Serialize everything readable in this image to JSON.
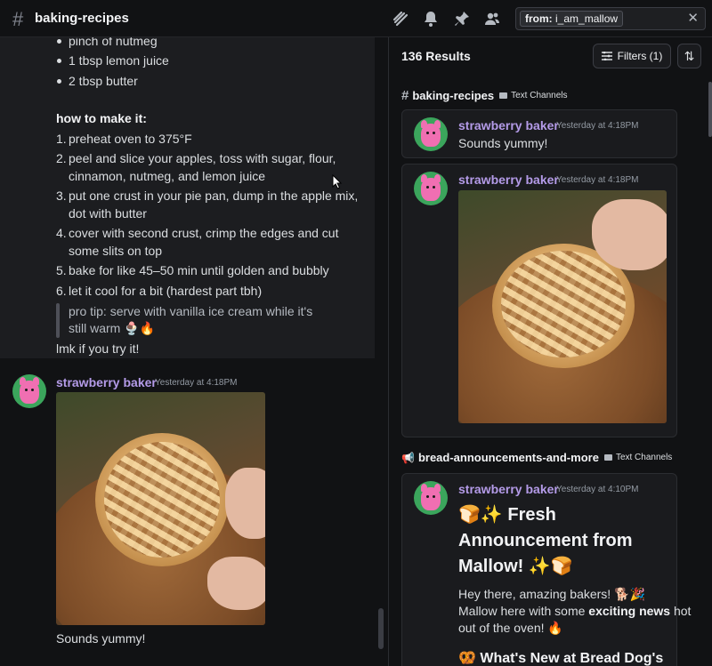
{
  "header": {
    "channel": "baking-recipes",
    "search_from": "from:",
    "search_user": "i_am_mallow",
    "icons": [
      "threads-icon",
      "bell-icon",
      "pin-icon",
      "members-icon"
    ]
  },
  "recipe": {
    "ingredients_tail": [
      "pinch of nutmeg",
      "1 tbsp lemon juice",
      "2 tbsp butter"
    ],
    "how_to_heading": "how to make it:",
    "steps": [
      {
        "n": "1.",
        "lines": [
          "preheat oven to 375°F"
        ]
      },
      {
        "n": "2.",
        "lines": [
          "peel and slice your apples, toss with sugar, flour,",
          "cinnamon, nutmeg, and lemon juice"
        ]
      },
      {
        "n": "3.",
        "lines": [
          "put one crust in your pie pan, dump in the apple mix,",
          "dot with butter"
        ]
      },
      {
        "n": "4.",
        "lines": [
          "cover with second crust, crimp the edges and cut",
          "some slits on top"
        ]
      },
      {
        "n": "5.",
        "lines": [
          "bake for like 45–50 min until golden and bubbly"
        ]
      },
      {
        "n": "6.",
        "lines": [
          "let it cool for a bit (hardest part tbh)"
        ]
      }
    ],
    "tip_line1": "pro tip: serve with vanilla ice cream while it's",
    "tip_line2": "still warm 🍨🔥",
    "closing": "lmk if you try it!"
  },
  "left_message": {
    "author": "strawberry baker",
    "timestamp": "Yesterday at 4:18PM",
    "text": "Sounds yummy!"
  },
  "results_panel": {
    "count": "136 Results",
    "filters_label": "Filters (1)",
    "groups": [
      {
        "channel": "baking-recipes",
        "category": "Text Channels",
        "results": [
          {
            "author": "strawberry baker",
            "timestamp": "Yesterday at 4:18PM",
            "text": "Sounds yummy!"
          },
          {
            "author": "strawberry baker",
            "timestamp": "Yesterday at 4:18PM",
            "text": ""
          }
        ]
      },
      {
        "channel": "bread-announcements-and-more",
        "category": "Text Channels",
        "results": [
          {
            "author": "strawberry baker",
            "timestamp": "Yesterday at 4:10PM",
            "title_line1": "🍞✨ Fresh",
            "title_line2": "Announcement from",
            "title_line3": "Mallow! ✨🍞",
            "body_line1": "Hey there, amazing bakers! 🐕🎉",
            "body_line2_pre": "Mallow here with some ",
            "body_line2_bold": "exciting news",
            "body_line2_post": " hot",
            "body_line3": "out of the oven! 🔥",
            "subheading": "🥨 What's New at Bread Dog's"
          }
        ]
      }
    ]
  }
}
